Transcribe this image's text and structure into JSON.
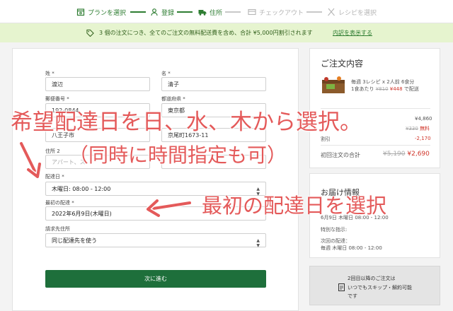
{
  "steps": [
    {
      "label": "プランを選択",
      "state": "done",
      "icon": "store-icon"
    },
    {
      "label": "登録",
      "state": "done",
      "icon": "person-icon"
    },
    {
      "label": "住所",
      "state": "done",
      "icon": "truck-icon"
    },
    {
      "label": "チェックアウト",
      "state": "todo",
      "icon": "card-icon"
    },
    {
      "label": "レシピを選択",
      "state": "todo",
      "icon": "utensils-icon"
    }
  ],
  "promo": {
    "text": "3 個の注文につき、全てのご注文の無料配送費を含め、合計 ¥5,000円割引されます",
    "link": "内訳を表示する",
    "icon": "tag-icon"
  },
  "form": {
    "last_name": {
      "label": "姓 *",
      "value": "渡辺"
    },
    "first_name": {
      "label": "名 *",
      "value": "清子"
    },
    "postal": {
      "label": "郵便番号 *",
      "value": "192-0844"
    },
    "prefecture": {
      "label": "都道府県 *",
      "value": "東京都"
    },
    "city": {
      "value": "八王子市"
    },
    "address": {
      "value": "京尾町1673-11"
    },
    "address2": {
      "label": "住所 2",
      "placeholder": "アパート、ス"
    },
    "delivery_day": {
      "label": "配達日 *",
      "value": "木曜日: 08:00 - 12:00"
    },
    "first_delivery": {
      "label": "最初の配達 *",
      "value": "2022年6月9日(木曜日)"
    },
    "billing": {
      "label": "請求先住所",
      "value": "同じ配達先を使う"
    },
    "next_button": "次に進む"
  },
  "summary": {
    "title": "ご注文内容",
    "plan_line1": "毎週 3レシピ x 2人前 6食分",
    "plan_line2_prefix": "1食あたり",
    "plan_old_price": "¥810",
    "plan_new_price": "¥448",
    "plan_line2_suffix": "で配送",
    "subtotal": "¥4,860",
    "shipping_old": "¥330",
    "shipping_free": "無料",
    "discount_label": "割引",
    "discount_value": "-2,170",
    "total_label": "初回注文の合計",
    "total_old": "¥5,190",
    "total_new": "¥2,690"
  },
  "delivery": {
    "title": "お届け情報",
    "first_line": "6月9日 木曜日 08:00 - 12:00",
    "instructions_label": "特別な指示:",
    "next_label": "次回の配達：",
    "next_value": "毎週 木曜日 08:00 - 12:00"
  },
  "skip_box": {
    "line1": "2回目以降のご注文は",
    "line2": "いつでもスキップ・解約可能",
    "line3": "です",
    "icon": "document-icon"
  },
  "annotations": {
    "main": "希望配達日を日、水、木から選択。",
    "sub": "（同時に時間指定も可）",
    "first": "最初の配達日を選択"
  },
  "colors": {
    "brand_green": "#2e7d32",
    "button_green": "#1e6f3b",
    "promo_bg": "#e6f4cf",
    "annotation_red": "#e45a5a",
    "discount_red": "#d0362b"
  }
}
